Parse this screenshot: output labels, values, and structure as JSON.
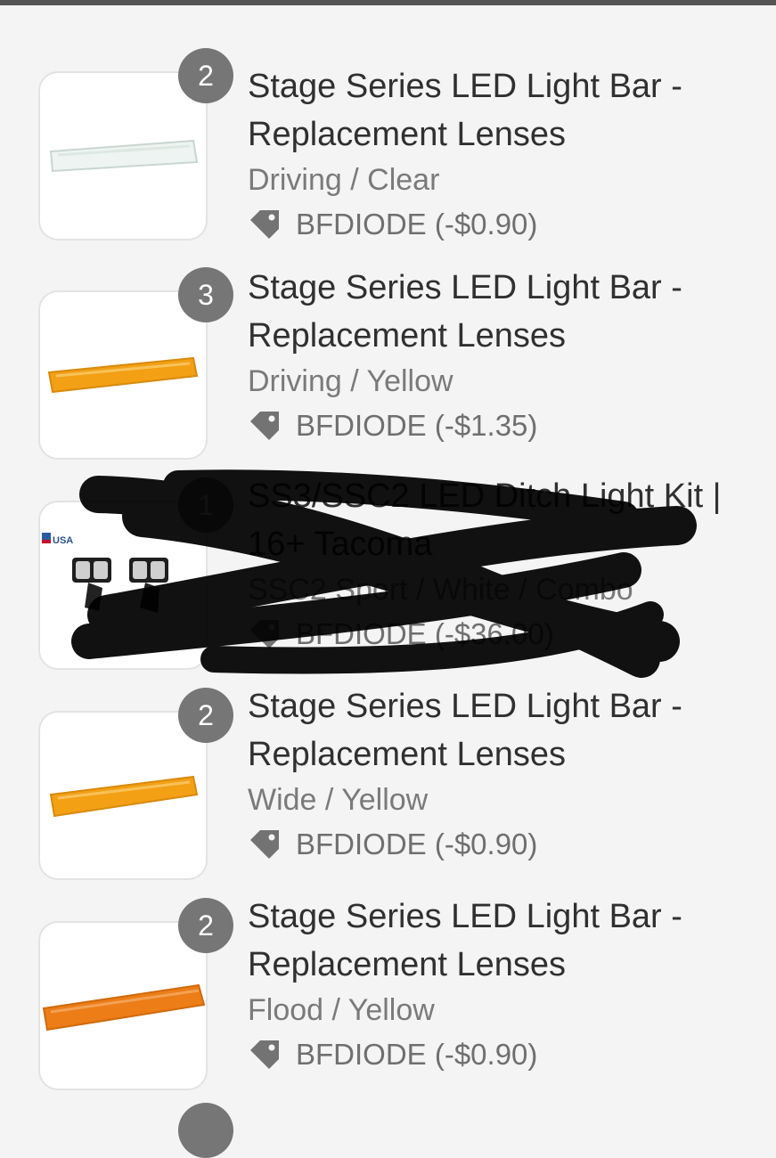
{
  "colors": {
    "background": "#f4f4f4",
    "badge": "#767676",
    "title": "#303030",
    "muted": "#7a7a7a",
    "amber": "#f3a015",
    "orange": "#ec7d17"
  },
  "icons": {
    "discount": "tag-icon"
  },
  "items": [
    {
      "quantity": "2",
      "title": "Stage Series LED Light Bar - Replacement Lenses",
      "variant": "Driving / Clear",
      "discount": "BFDIODE (-$0.90)",
      "image": "clear-lens"
    },
    {
      "quantity": "3",
      "title": "Stage Series LED Light Bar - Replacement Lenses",
      "variant": "Driving / Yellow",
      "discount": "BFDIODE (-$1.35)",
      "image": "yellow-lens"
    },
    {
      "quantity": "1",
      "title": "SS3/SSC2 LED Ditch Light Kit | 16+ Tacoma",
      "variant": "SSC2 Sport / White / Combo",
      "discount": "BFDIODE (-$36.00)",
      "image": "ditch-light-kit",
      "image_badge": "USA",
      "redacted": true
    },
    {
      "quantity": "2",
      "title": "Stage Series LED Light Bar - Replacement Lenses",
      "variant": "Wide / Yellow",
      "discount": "BFDIODE (-$0.90)",
      "image": "yellow-lens"
    },
    {
      "quantity": "2",
      "title": "Stage Series LED Light Bar - Replacement Lenses",
      "variant": "Flood / Yellow",
      "discount": "BFDIODE (-$0.90)",
      "image": "orange-lens"
    }
  ]
}
